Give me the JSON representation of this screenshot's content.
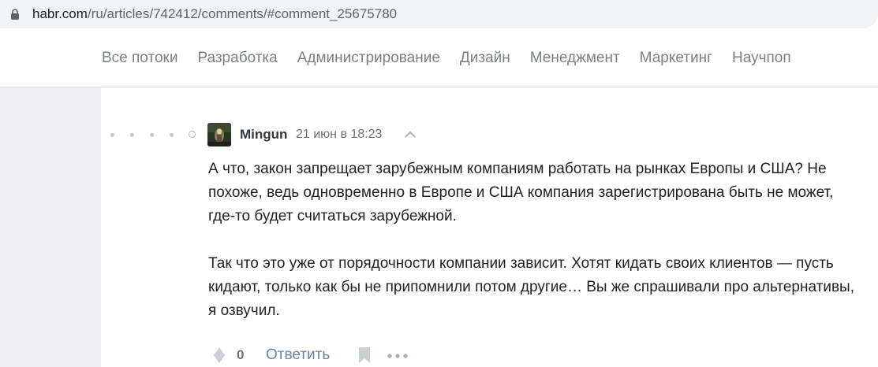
{
  "browser": {
    "url_host": "habr.com",
    "url_path": "/ru/articles/742412/comments/#comment_25675780"
  },
  "nav": {
    "items": [
      {
        "label": "Все потоки"
      },
      {
        "label": "Разработка"
      },
      {
        "label": "Администрирование"
      },
      {
        "label": "Дизайн"
      },
      {
        "label": "Менеджмент"
      },
      {
        "label": "Маркетинг"
      },
      {
        "label": "Научпоп"
      }
    ]
  },
  "comment": {
    "author": "Mingun",
    "timestamp": "21 июн в 18:23",
    "paragraphs": [
      "А что, закон запрещает зарубежным компаниям работать на рынках Европы и США? Не похоже, ведь одновременно в Европе и США компания зарегистрирована быть не может, где-то будет считаться зарубежной.",
      "Так что это уже от порядочности компании зависит. Хотят кидать своих клиентов — пусть кидают, только как бы не припомнили потом другие… Вы же спрашивали про альтернативы, я озвучил."
    ],
    "votes": "0",
    "reply_label": "Ответить"
  },
  "colors": {
    "nav_text": "#7b8083",
    "link": "#5e87a8",
    "background": "#f0f0f2"
  },
  "icons": [
    "lock-icon",
    "avatar",
    "chevron-up-icon",
    "vote-icon",
    "bookmark-icon",
    "more-icon"
  ]
}
